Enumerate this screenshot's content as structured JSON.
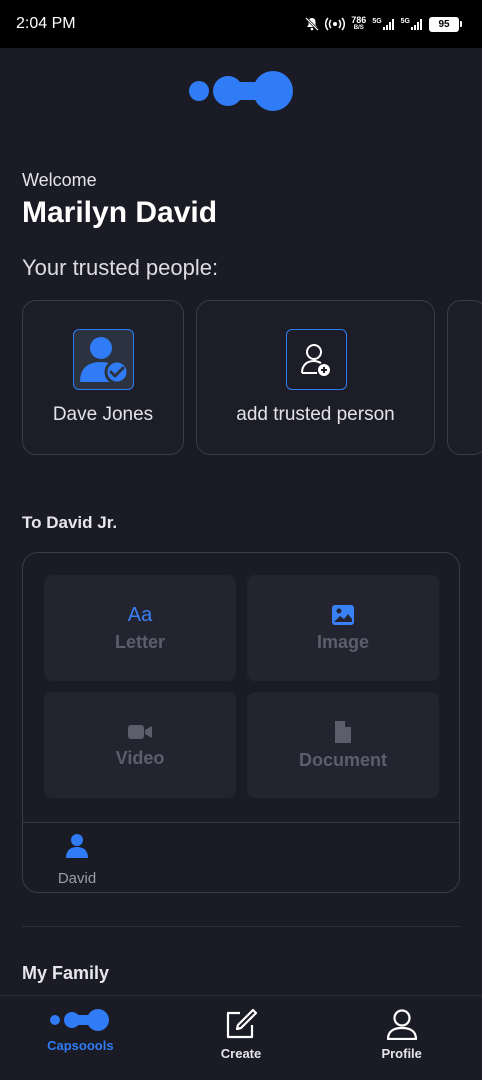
{
  "status_bar": {
    "time": "2:04 PM",
    "net_speed_value": "786",
    "net_speed_unit": "B/S",
    "sim1": "5G",
    "sim2": "5G",
    "battery": "95"
  },
  "header": {
    "logo_icon": "capsule-logo-icon"
  },
  "greeting": {
    "welcome": "Welcome",
    "name": "Marilyn David"
  },
  "trusted": {
    "title": "Your trusted people:",
    "people": [
      {
        "name": "Dave Jones",
        "icon": "verified-user-icon"
      },
      {
        "name": "add trusted person",
        "icon": "add-user-icon"
      }
    ]
  },
  "capsule": {
    "title": "To David Jr.",
    "tiles": [
      {
        "label": "Letter",
        "icon": "text-aa-icon",
        "icon_text": "Aa"
      },
      {
        "label": "Image",
        "icon": "image-icon"
      },
      {
        "label": "Video",
        "icon": "video-camera-icon"
      },
      {
        "label": "Document",
        "icon": "document-icon"
      }
    ],
    "recipient": "David"
  },
  "family": {
    "title": "My Family"
  },
  "bottom_nav": {
    "items": [
      {
        "label": "Capsoools",
        "icon": "capsule-logo-icon",
        "active": true
      },
      {
        "label": "Create",
        "icon": "edit-icon",
        "active": false
      },
      {
        "label": "Profile",
        "icon": "person-icon",
        "active": false
      }
    ]
  },
  "colors": {
    "background": "#1a1b24",
    "accent": "#2f7cf6",
    "tile": "#23242f",
    "border": "#3a3c48"
  }
}
